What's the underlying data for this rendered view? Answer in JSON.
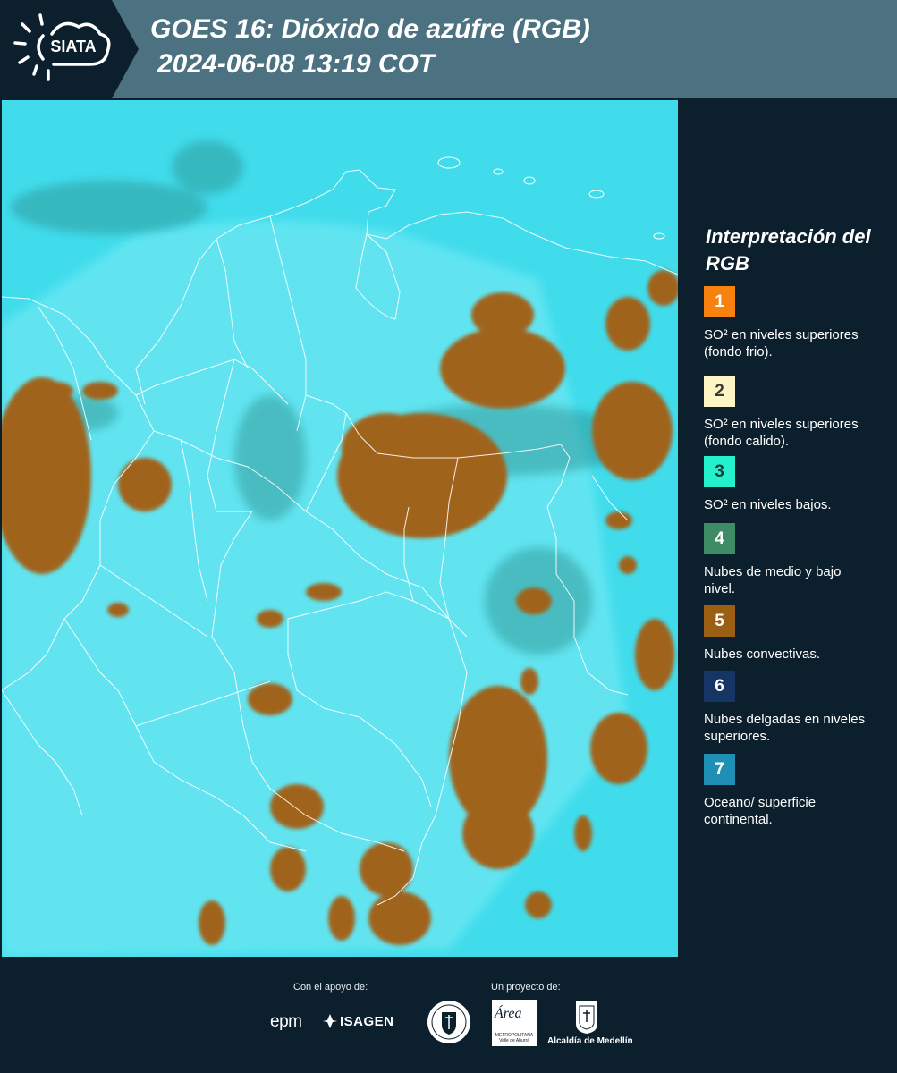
{
  "header": {
    "logo_text": "SIATA",
    "title_line1": "GOES 16: Dióxido de azúfre (RGB)",
    "title_line2": "2024-06-08 13:19 COT",
    "background_color": "#4c7282"
  },
  "legend": {
    "title": "Interpretación del RGB",
    "items": [
      {
        "number": "1",
        "label": "SO² en niveles superiores (fondo frio).",
        "color": "#f7820f",
        "text_color": "#ffffff"
      },
      {
        "number": "2",
        "label": "SO² en niveles superiores (fondo calido).",
        "color": "#fdf5c4",
        "text_color": "#3a3a3a"
      },
      {
        "number": "3",
        "label": "SO² en niveles bajos.",
        "color": "#25f0cc",
        "text_color": "#1a3a3a"
      },
      {
        "number": "4",
        "label": "Nubes de medio y bajo nivel.",
        "color": "#3d8c65",
        "text_color": "#ffffff"
      },
      {
        "number": "5",
        "label": "Nubes convectivas.",
        "color": "#9a5f12",
        "text_color": "#ffffff"
      },
      {
        "number": "6",
        "label": "Nubes delgadas en niveles superiores.",
        "color": "#153564",
        "text_color": "#ffffff"
      },
      {
        "number": "7",
        "label": "Oceano/ superficie continental.",
        "color": "#1f8fb6",
        "text_color": "#ffffff"
      }
    ]
  },
  "footer": {
    "support_label": "Con el apoyo de:",
    "project_label": "Un proyecto de:",
    "sponsor_1": "epm",
    "sponsor_2": "ISAGEN",
    "partner_area": "Área",
    "partner_area_sub": "METROPOLITANA Valle de Aburrá",
    "partner_alcaldia": "Alcaldía de Medellín"
  },
  "map": {
    "background_color": "#40dcec",
    "cloud_color": "#a0631d",
    "border_color": "#ffffff"
  }
}
